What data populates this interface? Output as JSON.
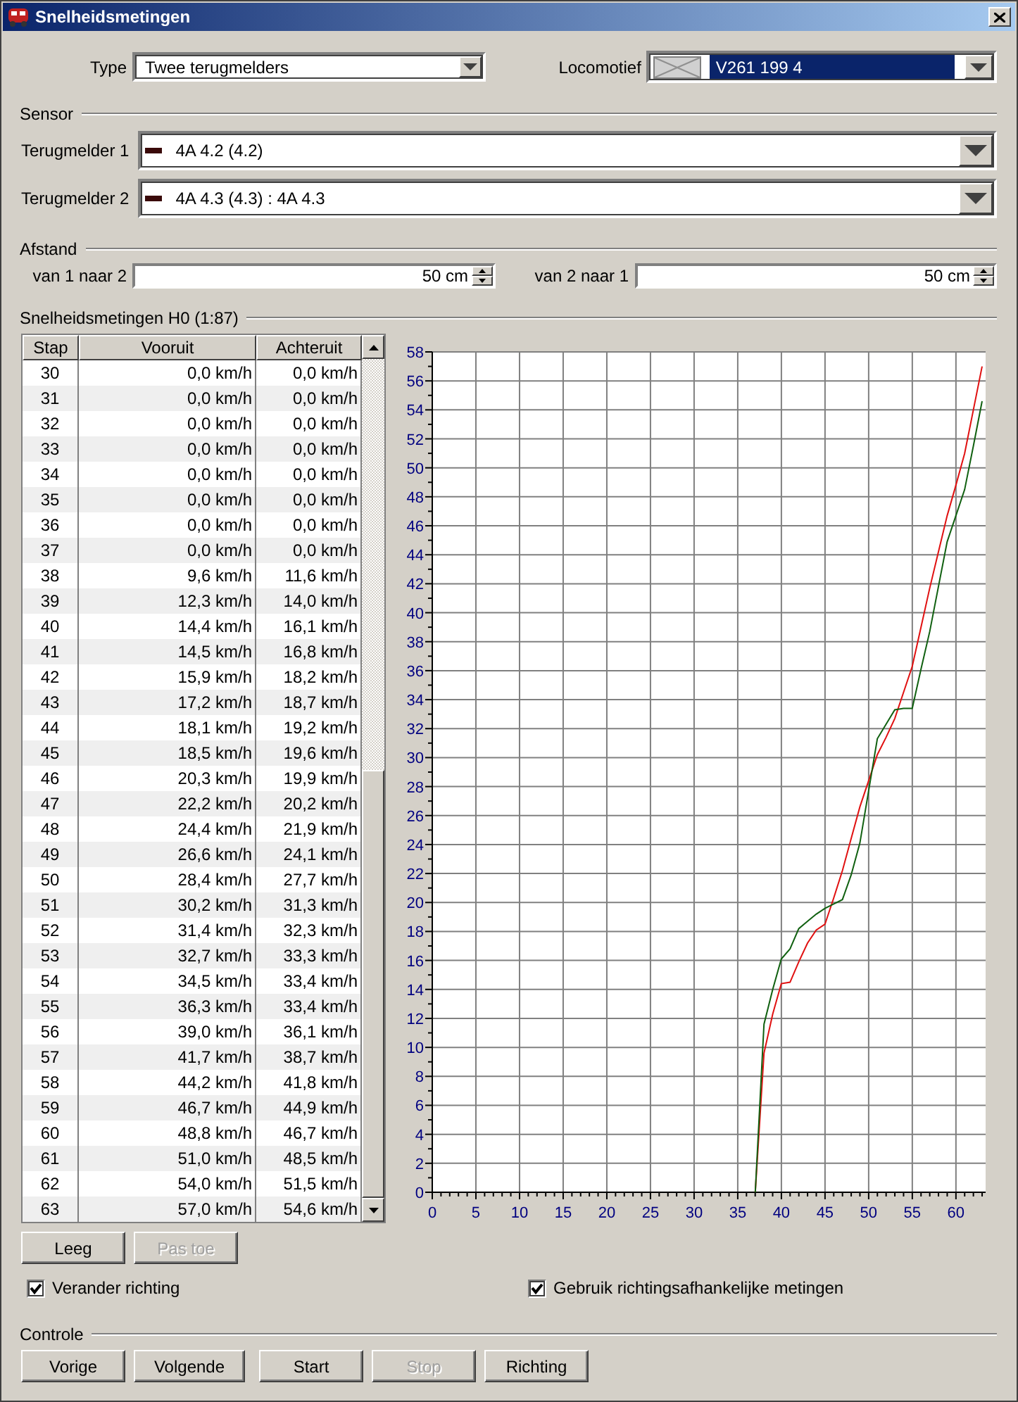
{
  "window": {
    "title": "Snelheidsmetingen"
  },
  "type": {
    "label": "Type",
    "value": "Twee terugmelders"
  },
  "locomotive": {
    "label": "Locomotief",
    "value": "V261 199 4",
    "highlighted": true
  },
  "sensor": {
    "title": "Sensor",
    "fields": [
      {
        "label": "Terugmelder 1",
        "value": "4A 4.2 (4.2)"
      },
      {
        "label": "Terugmelder 2",
        "value": "4A 4.3 (4.3) : 4A 4.3"
      }
    ]
  },
  "distance": {
    "title": "Afstand",
    "fields": [
      {
        "label": "van 1 naar 2",
        "value": "50 cm"
      },
      {
        "label": "van 2 naar 1",
        "value": "50 cm"
      }
    ]
  },
  "measurements": {
    "title": "Snelheidsmetingen H0 (1:87)",
    "table": {
      "columns": [
        "Stap",
        "Vooruit",
        "Achteruit"
      ],
      "rows": [
        [
          "30",
          "0,0 km/h",
          "0,0 km/h"
        ],
        [
          "31",
          "0,0 km/h",
          "0,0 km/h"
        ],
        [
          "32",
          "0,0 km/h",
          "0,0 km/h"
        ],
        [
          "33",
          "0,0 km/h",
          "0,0 km/h"
        ],
        [
          "34",
          "0,0 km/h",
          "0,0 km/h"
        ],
        [
          "35",
          "0,0 km/h",
          "0,0 km/h"
        ],
        [
          "36",
          "0,0 km/h",
          "0,0 km/h"
        ],
        [
          "37",
          "0,0 km/h",
          "0,0 km/h"
        ],
        [
          "38",
          "9,6 km/h",
          "11,6 km/h"
        ],
        [
          "39",
          "12,3 km/h",
          "14,0 km/h"
        ],
        [
          "40",
          "14,4 km/h",
          "16,1 km/h"
        ],
        [
          "41",
          "14,5 km/h",
          "16,8 km/h"
        ],
        [
          "42",
          "15,9 km/h",
          "18,2 km/h"
        ],
        [
          "43",
          "17,2 km/h",
          "18,7 km/h"
        ],
        [
          "44",
          "18,1 km/h",
          "19,2 km/h"
        ],
        [
          "45",
          "18,5 km/h",
          "19,6 km/h"
        ],
        [
          "46",
          "20,3 km/h",
          "19,9 km/h"
        ],
        [
          "47",
          "22,2 km/h",
          "20,2 km/h"
        ],
        [
          "48",
          "24,4 km/h",
          "21,9 km/h"
        ],
        [
          "49",
          "26,6 km/h",
          "24,1 km/h"
        ],
        [
          "50",
          "28,4 km/h",
          "27,7 km/h"
        ],
        [
          "51",
          "30,2 km/h",
          "31,3 km/h"
        ],
        [
          "52",
          "31,4 km/h",
          "32,3 km/h"
        ],
        [
          "53",
          "32,7 km/h",
          "33,3 km/h"
        ],
        [
          "54",
          "34,5 km/h",
          "33,4 km/h"
        ],
        [
          "55",
          "36,3 km/h",
          "33,4 km/h"
        ],
        [
          "56",
          "39,0 km/h",
          "36,1 km/h"
        ],
        [
          "57",
          "41,7 km/h",
          "38,7 km/h"
        ],
        [
          "58",
          "44,2 km/h",
          "41,8 km/h"
        ],
        [
          "59",
          "46,7 km/h",
          "44,9 km/h"
        ],
        [
          "60",
          "48,8 km/h",
          "46,7 km/h"
        ],
        [
          "61",
          "51,0 km/h",
          "48,5 km/h"
        ],
        [
          "62",
          "54,0 km/h",
          "51,5 km/h"
        ],
        [
          "63",
          "57,0 km/h",
          "54,6 km/h"
        ]
      ]
    },
    "chart_data": {
      "type": "line",
      "x": [
        37,
        38,
        39,
        40,
        41,
        42,
        43,
        44,
        45,
        46,
        47,
        48,
        49,
        50,
        51,
        52,
        53,
        54,
        55,
        56,
        57,
        58,
        59,
        60,
        61,
        62,
        63
      ],
      "series": [
        {
          "color": "#e01010",
          "values": [
            0,
            9.6,
            12.3,
            14.4,
            14.5,
            15.9,
            17.2,
            18.1,
            18.5,
            20.3,
            22.2,
            24.4,
            26.6,
            28.4,
            30.2,
            31.4,
            32.7,
            34.5,
            36.3,
            39.0,
            41.7,
            44.2,
            46.7,
            48.8,
            51.0,
            54.0,
            57.0
          ]
        },
        {
          "color": "#106010",
          "values": [
            0,
            11.6,
            14.0,
            16.1,
            16.8,
            18.2,
            18.7,
            19.2,
            19.6,
            19.9,
            20.2,
            21.9,
            24.1,
            27.7,
            31.3,
            32.3,
            33.3,
            33.4,
            33.4,
            36.1,
            38.7,
            41.8,
            44.9,
            46.7,
            48.5,
            51.5,
            54.6
          ]
        }
      ],
      "grid": true,
      "xlim": [
        0,
        63.4
      ],
      "ylim": [
        0,
        58
      ],
      "xticks": [
        0,
        5,
        10,
        15,
        20,
        25,
        30,
        35,
        40,
        45,
        50,
        55,
        60
      ],
      "yticks": [
        0,
        2,
        4,
        6,
        8,
        10,
        12,
        14,
        16,
        18,
        20,
        22,
        24,
        26,
        28,
        30,
        32,
        34,
        36,
        38,
        40,
        42,
        44,
        46,
        48,
        50,
        52,
        54,
        56,
        58
      ]
    },
    "buttons": [
      {
        "label": "Leeg",
        "disabled": false
      },
      {
        "label": "Pas toe",
        "disabled": true
      }
    ],
    "options": [
      {
        "label": "Verander richting",
        "checked": true
      },
      {
        "label": "Gebruik richtingsafhankelijke metingen",
        "checked": true
      }
    ]
  },
  "controls": {
    "title": "Controle",
    "buttons": [
      {
        "label": "Vorige",
        "disabled": false
      },
      {
        "label": "Volgende",
        "disabled": false
      },
      {
        "label": "Start",
        "disabled": false
      },
      {
        "label": "Stop",
        "disabled": true
      },
      {
        "label": "Richting",
        "disabled": false
      }
    ]
  }
}
